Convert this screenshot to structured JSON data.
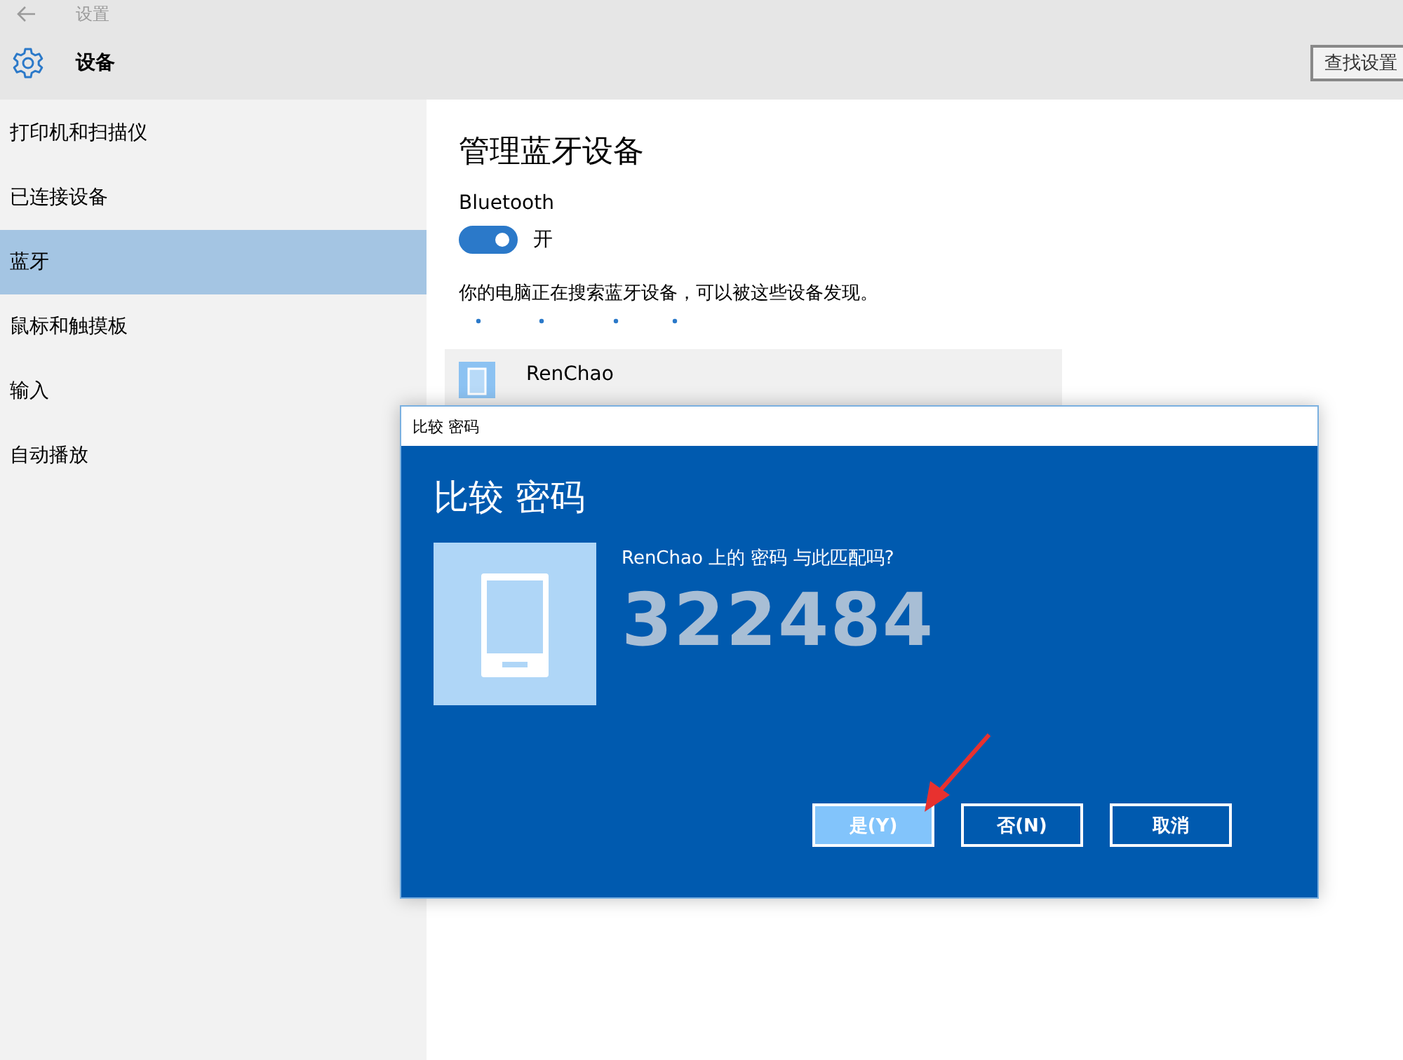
{
  "window": {
    "title": "设置"
  },
  "header": {
    "title": "设备",
    "search": {
      "placeholder": "查找设置"
    }
  },
  "sidebar": {
    "items": [
      {
        "label": "打印机和扫描仪",
        "selected": false
      },
      {
        "label": "已连接设备",
        "selected": false
      },
      {
        "label": "蓝牙",
        "selected": true
      },
      {
        "label": "鼠标和触摸板",
        "selected": false
      },
      {
        "label": "输入",
        "selected": false
      },
      {
        "label": "自动播放",
        "selected": false
      }
    ]
  },
  "content": {
    "heading": "管理蓝牙设备",
    "bluetooth": {
      "label": "Bluetooth",
      "on": true,
      "state_label": "开"
    },
    "status": "你的电脑正在搜索蓝牙设备，可以被这些设备发现。",
    "devices": [
      {
        "name": "RenChao"
      }
    ]
  },
  "dialog": {
    "title": "比较 密码",
    "heading": "比较 密码",
    "question": "RenChao 上的 密码 与此匹配吗?",
    "code": "322484",
    "buttons": [
      {
        "label": "是(Y)",
        "selected": true
      },
      {
        "label": "否(N)",
        "selected": false
      },
      {
        "label": "取消",
        "selected": false
      }
    ]
  }
}
